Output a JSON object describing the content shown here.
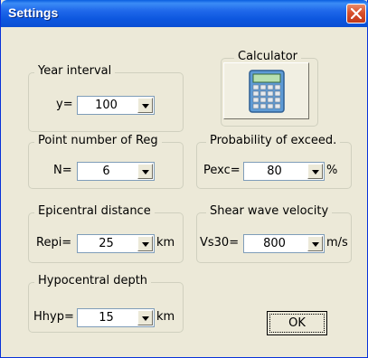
{
  "window": {
    "title": "Settings"
  },
  "groups": {
    "year_interval": {
      "label": "Year interval",
      "field_label": "y=",
      "value": "100"
    },
    "calculator": {
      "label": "Calculator"
    },
    "point_number": {
      "label": "Point number of Reg",
      "field_label": "N=",
      "value": "6"
    },
    "probability": {
      "label": "Probability of exceed.",
      "field_label": "Pexc=",
      "value": "80",
      "unit": "%"
    },
    "epicentral": {
      "label": "Epicentral distance",
      "field_label": "Repi=",
      "value": "25",
      "unit": "km"
    },
    "shear_wave": {
      "label": "Shear wave velocity",
      "field_label": "Vs30=",
      "value": "800",
      "unit": "m/s"
    },
    "hypocentral": {
      "label": "Hypocentral depth",
      "field_label": "Hhyp=",
      "value": "15",
      "unit": "km"
    }
  },
  "buttons": {
    "ok": "OK"
  },
  "icons": {
    "close": "close-icon",
    "calculator": "calculator-icon",
    "dropdown": "chevron-down-icon"
  },
  "colors": {
    "titlebar": "#0a5ee0",
    "close": "#d8502c",
    "face": "#ece9d8"
  }
}
